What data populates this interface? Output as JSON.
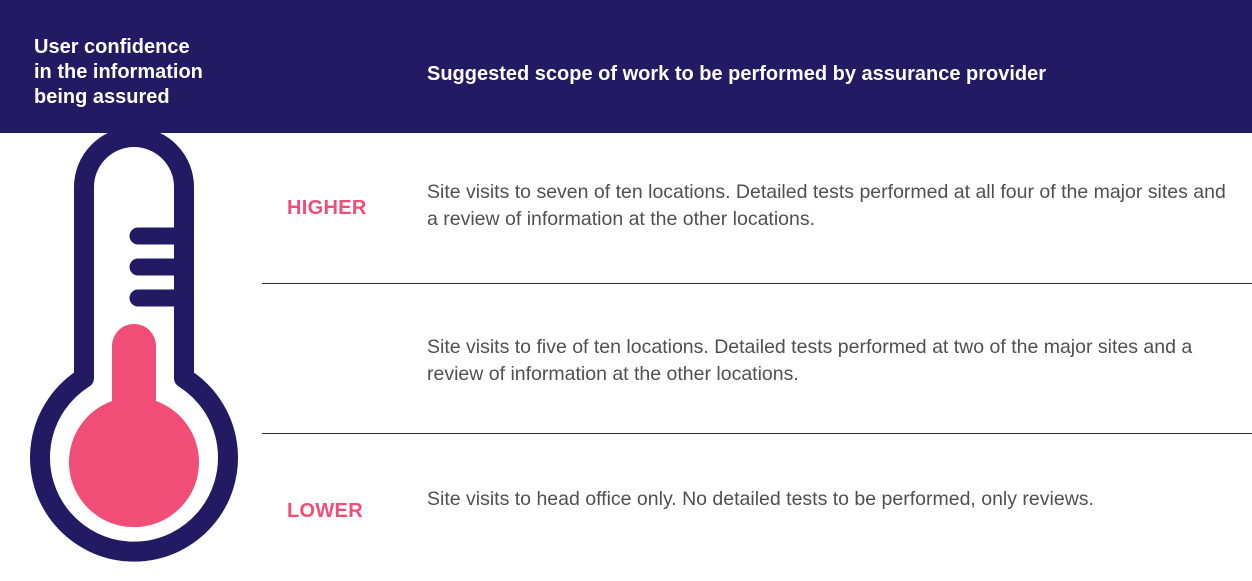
{
  "header": {
    "left_title": "User confidence\nin the information\nbeing assured",
    "right_title": "Suggested scope of work to be performed by assurance provider"
  },
  "rows": [
    {
      "level": "HIGHER",
      "description": "Site visits to seven of ten locations. Detailed tests performed at all four of the major sites and a review of information at the other locations."
    },
    {
      "level": "",
      "description": "Site visits to five of ten locations. Detailed tests performed at two of the major sites and a review of information at the other locations."
    },
    {
      "level": "LOWER",
      "description": "Site visits to head office only. No detailed tests to be performed, only reviews."
    }
  ],
  "thermometer": {
    "icon": "thermometer-icon",
    "level": 0.5
  },
  "colors": {
    "header_background": "#221b63",
    "header_text": "#ffffff",
    "accent": "#f04e76",
    "thermometer_outline": "#221b63",
    "body_text": "#505050",
    "divider": "#2c2c2c"
  }
}
